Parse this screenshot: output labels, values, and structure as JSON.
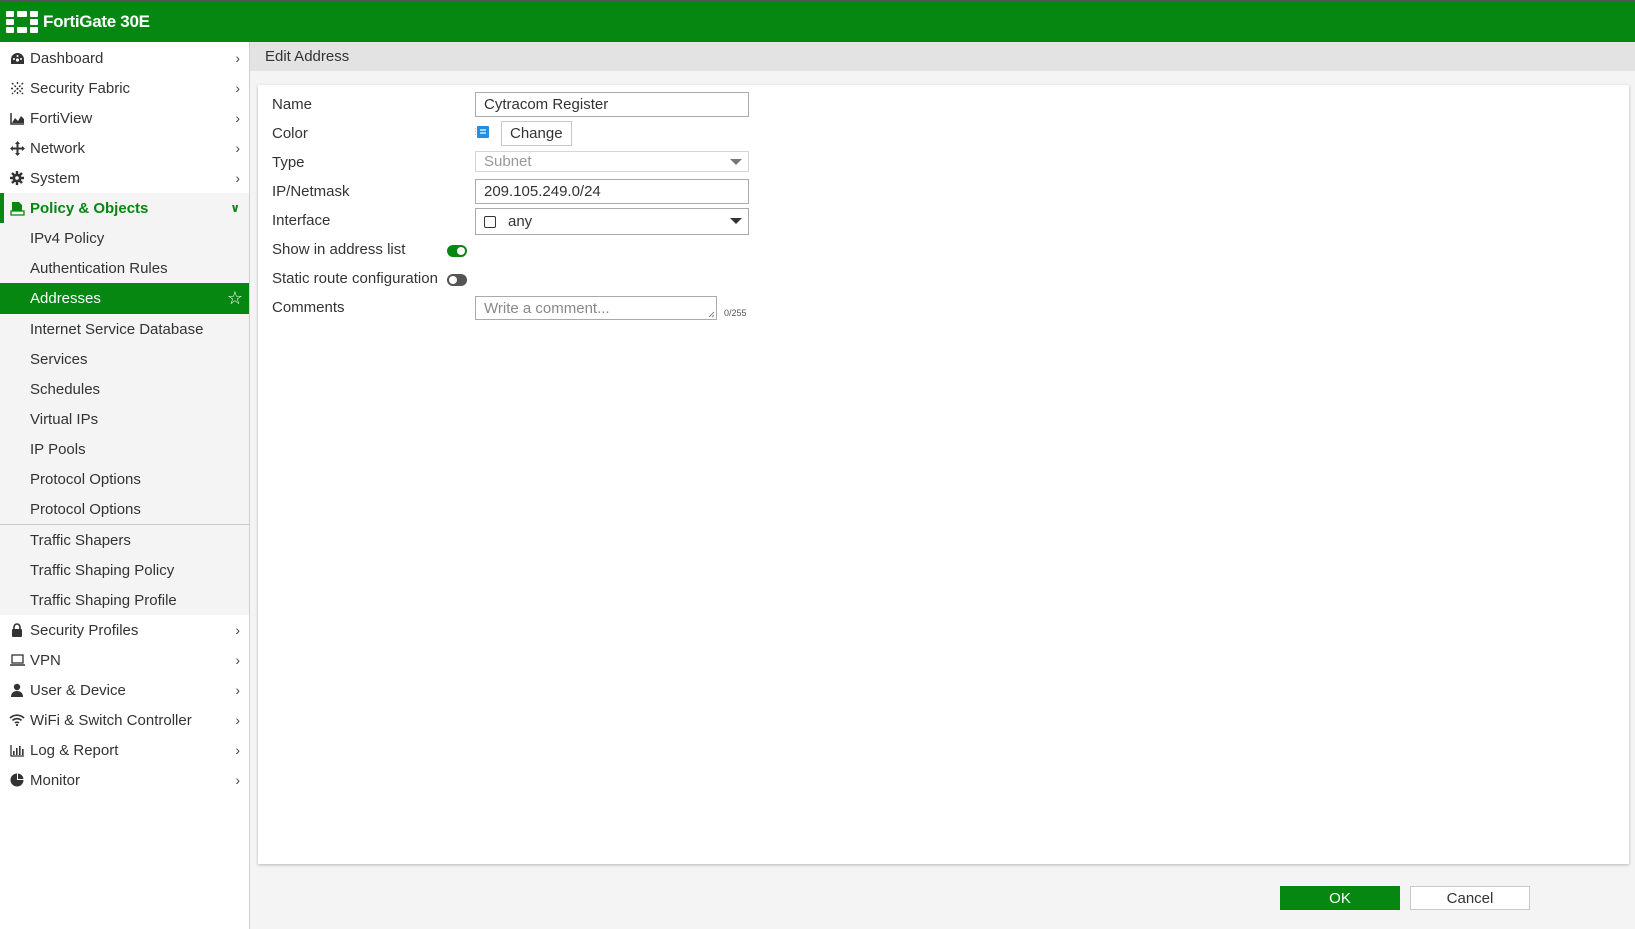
{
  "app": {
    "title": "FortiGate 30E",
    "brand_color": "#058712"
  },
  "sidebar": {
    "top_items": [
      {
        "label": "Dashboard",
        "icon": "dashboard-icon"
      },
      {
        "label": "Security Fabric",
        "icon": "security-fabric-icon"
      },
      {
        "label": "FortiView",
        "icon": "fortiview-icon"
      },
      {
        "label": "Network",
        "icon": "network-icon"
      },
      {
        "label": "System",
        "icon": "gear-icon"
      }
    ],
    "expanded": {
      "label": "Policy & Objects",
      "icon": "policy-icon"
    },
    "sub_items": [
      {
        "label": "IPv4 Policy"
      },
      {
        "label": "Authentication Rules"
      },
      {
        "label": "Addresses",
        "active": true
      },
      {
        "label": "Internet Service Database"
      },
      {
        "label": "Services"
      },
      {
        "label": "Schedules"
      },
      {
        "label": "Virtual IPs"
      },
      {
        "label": "IP Pools"
      },
      {
        "label": "Protocol Options"
      },
      {
        "label": "Protocol Options"
      }
    ],
    "sub_items_2": [
      {
        "label": "Traffic Shapers"
      },
      {
        "label": "Traffic Shaping Policy"
      },
      {
        "label": "Traffic Shaping Profile"
      }
    ],
    "bottom_items": [
      {
        "label": "Security Profiles",
        "icon": "lock-icon"
      },
      {
        "label": "VPN",
        "icon": "laptop-icon"
      },
      {
        "label": "User & Device",
        "icon": "user-icon"
      },
      {
        "label": "WiFi & Switch Controller",
        "icon": "wifi-icon"
      },
      {
        "label": "Log & Report",
        "icon": "bar-chart-icon"
      },
      {
        "label": "Monitor",
        "icon": "pie-chart-icon"
      }
    ]
  },
  "page": {
    "title": "Edit Address"
  },
  "form": {
    "name_label": "Name",
    "name_value": "Cytracom Register",
    "color_label": "Color",
    "change_label": "Change",
    "color_swatch": "#1e90e8",
    "type_label": "Type",
    "type_value": "Subnet",
    "ip_label": "IP/Netmask",
    "ip_value": "209.105.249.0/24",
    "interface_label": "Interface",
    "interface_value": "any",
    "show_label": "Show in address list",
    "show_enabled": true,
    "static_label": "Static route configuration",
    "static_enabled": false,
    "comments_label": "Comments",
    "comments_placeholder": "Write a comment...",
    "comments_counter": "0/255"
  },
  "footer": {
    "ok_label": "OK",
    "cancel_label": "Cancel"
  }
}
